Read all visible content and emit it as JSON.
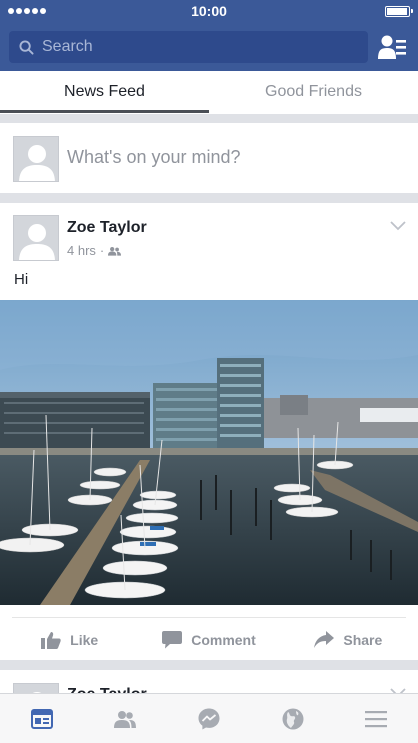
{
  "status_bar": {
    "time": "10:00",
    "battery_level": 1.0
  },
  "search": {
    "placeholder": "Search"
  },
  "tabs": [
    {
      "label": "News Feed",
      "active": true
    },
    {
      "label": "Good Friends",
      "active": false
    }
  ],
  "composer": {
    "placeholder": "What's on your mind?"
  },
  "post": {
    "author": "Zoe Taylor",
    "time": "4 hrs",
    "separator": "·",
    "audience_icon": "friends-icon",
    "text": "Hi",
    "photo": "harbor-marina-photo",
    "actions": [
      {
        "label": "Like",
        "icon": "thumbs-up-icon"
      },
      {
        "label": "Comment",
        "icon": "comment-icon"
      },
      {
        "label": "Share",
        "icon": "share-icon"
      }
    ]
  },
  "next_post": {
    "author": "Zoe Taylor"
  },
  "bottom_nav": [
    {
      "icon": "news-feed-icon",
      "active": true
    },
    {
      "icon": "friends-icon",
      "active": false
    },
    {
      "icon": "messenger-icon",
      "active": false
    },
    {
      "icon": "notifications-globe-icon",
      "active": false
    },
    {
      "icon": "menu-icon",
      "active": false
    }
  ],
  "colors": {
    "brand": "#3b5998",
    "active_nav": "#4267b2",
    "muted_text": "#90949c",
    "feed_background": "#dfe1e6"
  }
}
